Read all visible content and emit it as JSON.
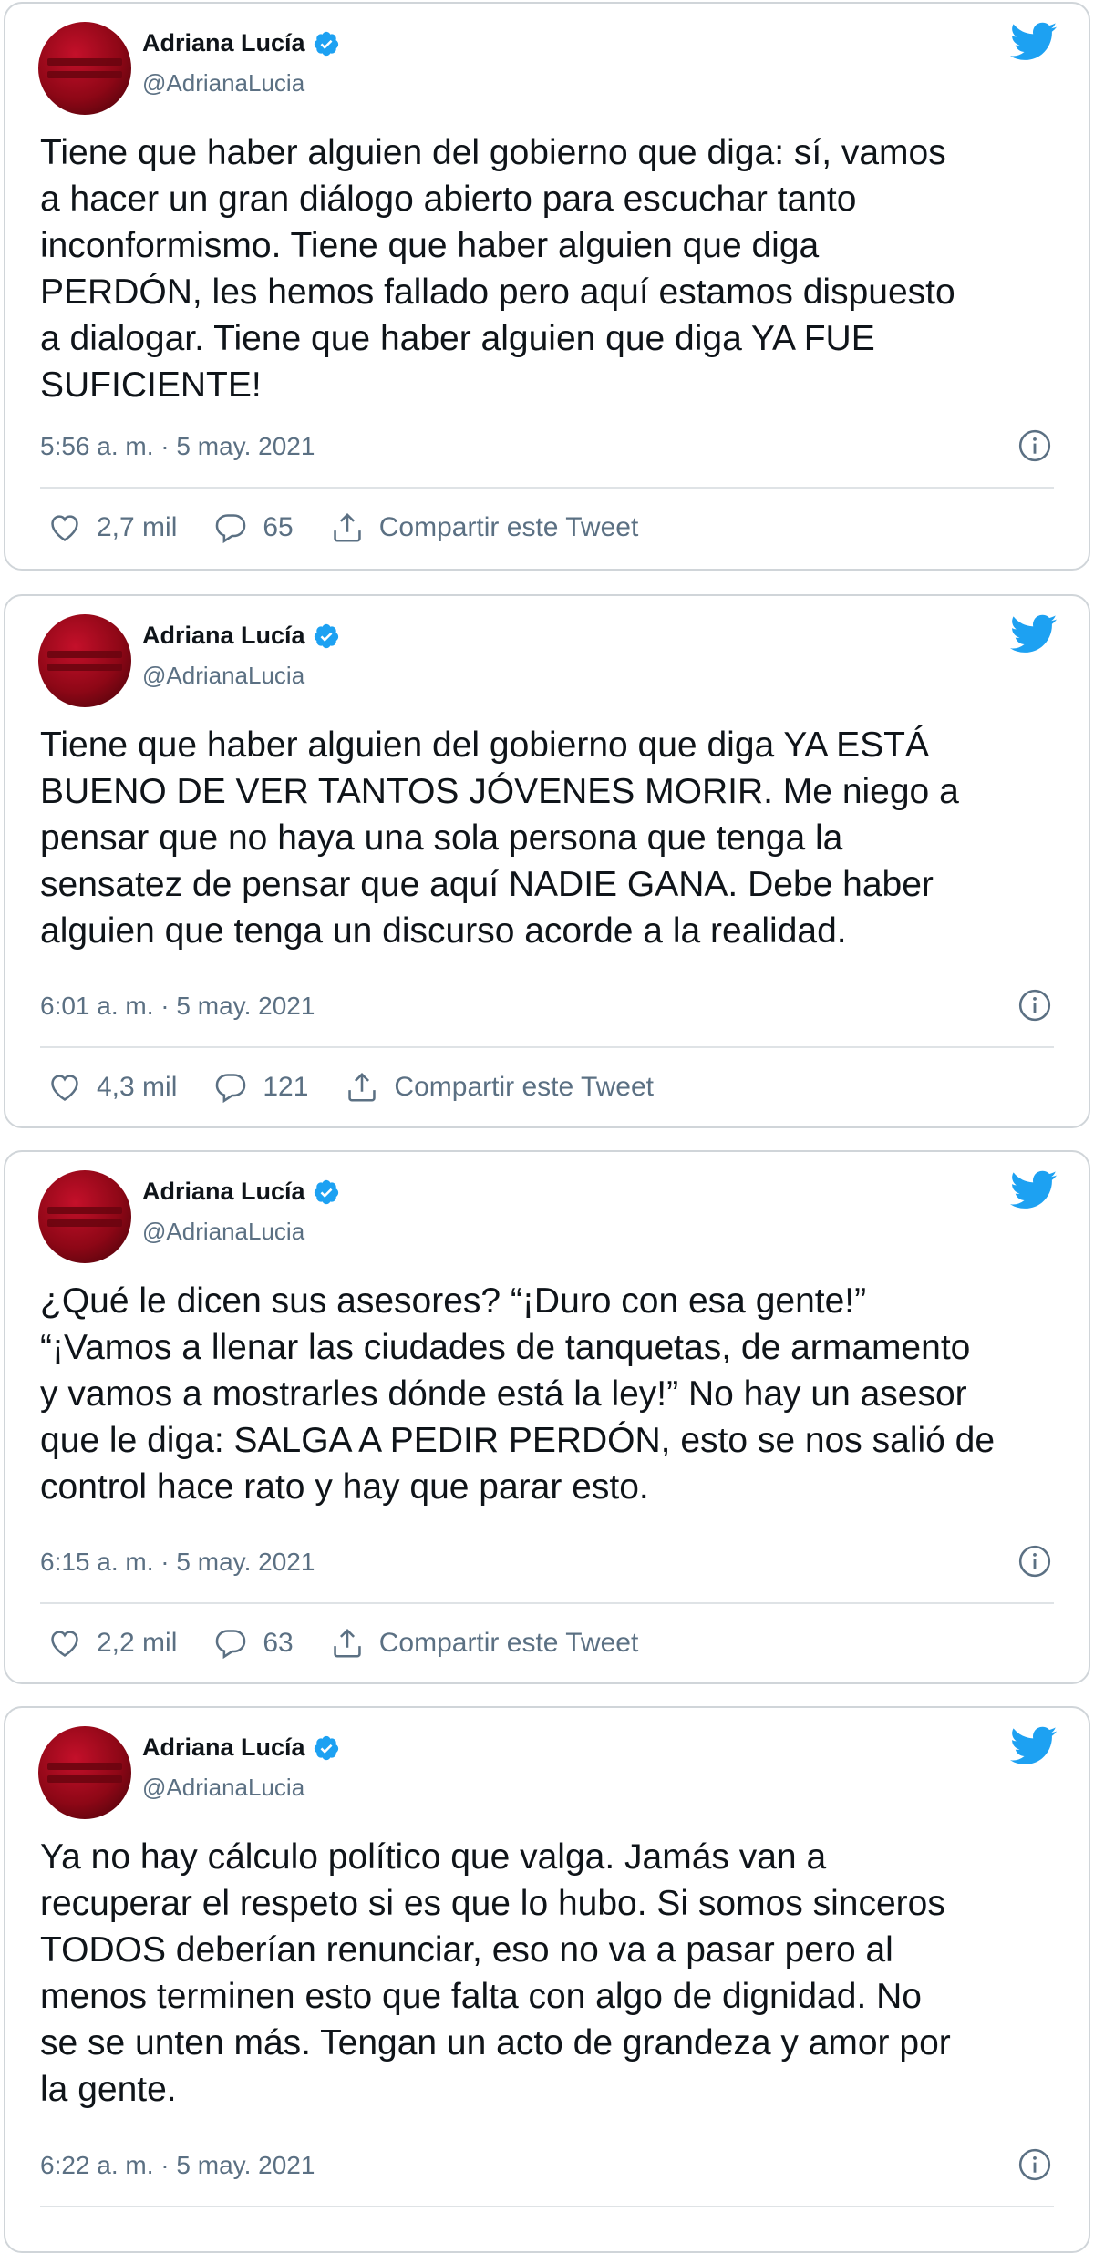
{
  "author": {
    "name": "Adriana Lucía",
    "handle": "@AdrianaLucia"
  },
  "tweets": [
    {
      "text": "Tiene que haber alguien del gobierno que diga: sí, vamos\na hacer un gran diálogo abierto para escuchar tanto\ninconformismo. Tiene que haber alguien que diga\nPERDÓN, les hemos fallado pero aquí estamos dispuesto\na dialogar. Tiene que haber alguien que diga YA FUE\nSUFICIENTE!",
      "timestamp": "5:56 a. m. · 5 may. 2021",
      "likes": "2,7 mil",
      "replies": "65",
      "share_label": "Compartir este Tweet"
    },
    {
      "text": "Tiene que haber alguien del gobierno que diga YA ESTÁ\nBUENO DE VER TANTOS JÓVENES MORIR. Me niego a\npensar que no haya una sola persona que tenga la\nsensatez de pensar que aquí NADIE GANA. Debe haber\nalguien que tenga un discurso acorde a la realidad.",
      "timestamp": "6:01 a. m. · 5 may. 2021",
      "likes": "4,3 mil",
      "replies": "121",
      "share_label": "Compartir este Tweet"
    },
    {
      "text": "¿Qué le dicen sus asesores? “¡Duro con esa gente!”\n“¡Vamos a llenar las ciudades de tanquetas, de armamento\ny vamos a mostrarles dónde está la ley!” No hay un asesor\nque le diga: SALGA A PEDIR PERDÓN, esto se nos salió de\ncontrol hace rato y hay que parar esto.",
      "timestamp": "6:15 a. m. · 5 may. 2021",
      "likes": "2,2 mil",
      "replies": "63",
      "share_label": "Compartir este Tweet"
    },
    {
      "text": "Ya no hay cálculo político que valga. Jamás van a\nrecuperar el respeto si es que lo hubo. Si somos sinceros\nTODOS deberían renunciar, eso no va a pasar pero al\nmenos terminen esto que falta con algo de dignidad. No\nse se unten más. Tengan un acto de grandeza y amor por\nla gente.",
      "timestamp": "6:22 a. m. · 5 may. 2021"
    }
  ],
  "colors": {
    "twitter_blue": "#1da1f2",
    "secondary_text": "#5b7083",
    "avatar_red": "#a30a1c"
  },
  "icons": {
    "verified": "verified-badge-icon",
    "logo": "twitter-bird-icon",
    "info": "info-icon",
    "like": "heart-icon",
    "reply": "reply-bubble-icon",
    "share": "share-icon"
  }
}
